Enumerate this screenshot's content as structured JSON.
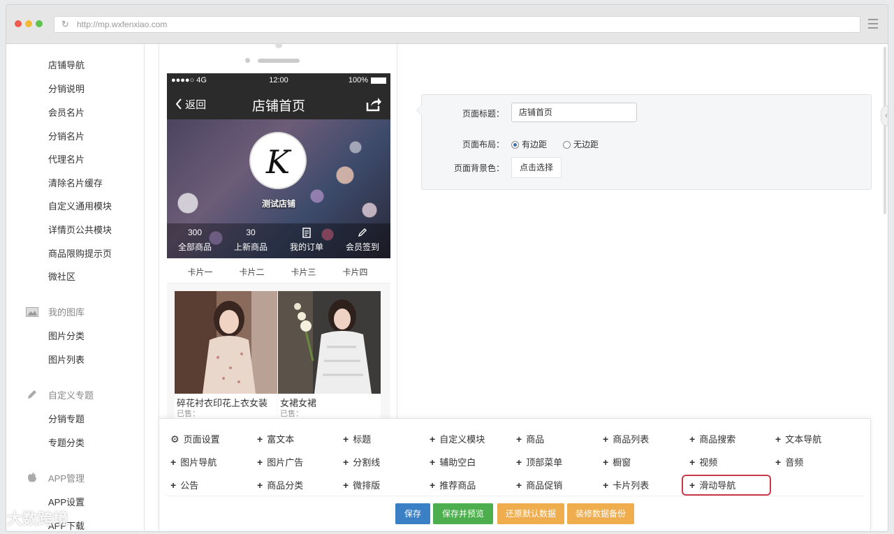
{
  "browser": {
    "url": "http://mp.wxfenxiao.com"
  },
  "sidebar": {
    "top_items": [
      "店铺导航",
      "分销说明",
      "会员名片",
      "分销名片",
      "代理名片",
      "清除名片缓存",
      "自定义通用模块",
      "详情页公共模块",
      "商品限购提示页",
      "微社区"
    ],
    "groups": [
      {
        "title": "我的图库",
        "icon": "image-icon",
        "items": [
          "图片分类",
          "图片列表"
        ]
      },
      {
        "title": "自定义专题",
        "icon": "pencil-icon",
        "items": [
          "分销专题",
          "专题分类"
        ]
      },
      {
        "title": "APP管理",
        "icon": "apple-icon",
        "items": [
          "APP设置",
          "APP下载"
        ]
      }
    ]
  },
  "phone": {
    "status": {
      "signal": "●●●●○ 4G",
      "time": "12:00",
      "battery": "100%"
    },
    "nav": {
      "back": "返回",
      "title": "店铺首页"
    },
    "shop_logo": "K",
    "shop_name": "测试店铺",
    "stats": [
      {
        "value": "300",
        "label": "全部商品",
        "icon": ""
      },
      {
        "value": "30",
        "label": "上新商品",
        "icon": ""
      },
      {
        "value": "",
        "label": "我的订单",
        "icon": "order-icon"
      },
      {
        "value": "",
        "label": "会员签到",
        "icon": "pen-icon"
      }
    ],
    "tabs": [
      "卡片一",
      "卡片二",
      "卡片三",
      "卡片四"
    ],
    "goods": [
      {
        "name": "碎花衬衣印花上衣女装",
        "sold": "已售："
      },
      {
        "name": "女裙女裙",
        "sold": "已售："
      }
    ]
  },
  "settings": {
    "title_label": "页面标题：",
    "title_value": "店铺首页",
    "layout_label": "页面布局：",
    "layout_options": [
      "有边距",
      "无边距"
    ],
    "layout_selected": "有边距",
    "bg_label": "页面背景色：",
    "bg_button": "点击选择"
  },
  "components": {
    "rows": [
      [
        "页面设置",
        "富文本",
        "标题",
        "自定义模块",
        "商品",
        "商品列表",
        "商品搜索",
        "文本导航"
      ],
      [
        "图片导航",
        "图片广告",
        "分割线",
        "辅助空白",
        "顶部菜单",
        "橱窗",
        "视频",
        "音频"
      ],
      [
        "公告",
        "商品分类",
        "微排版",
        "推荐商品",
        "商品促销",
        "卡片列表",
        "滑动导航"
      ]
    ],
    "highlighted": "滑动导航"
  },
  "actions": [
    {
      "label": "保存",
      "color": "#3b7fc4"
    },
    {
      "label": "保存并预览",
      "color": "#4cae4c"
    },
    {
      "label": "还原默认数据",
      "color": "#f0ad4e"
    },
    {
      "label": "装修数据备份",
      "color": "#f0ad4e"
    }
  ],
  "watermark": "大数跨境"
}
